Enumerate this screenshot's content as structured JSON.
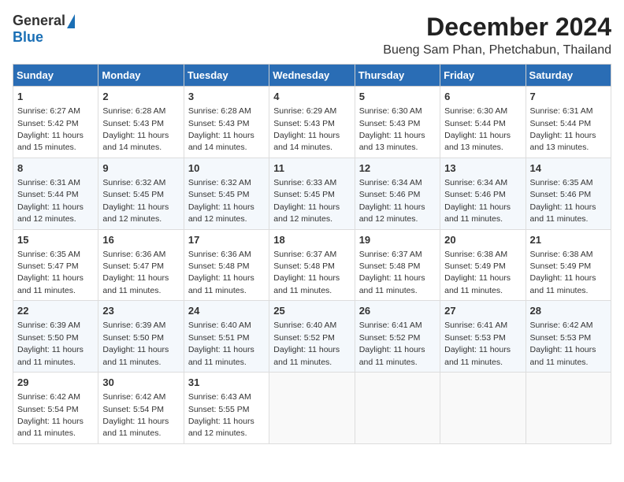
{
  "header": {
    "logo_general": "General",
    "logo_blue": "Blue",
    "month_title": "December 2024",
    "location": "Bueng Sam Phan, Phetchabun, Thailand"
  },
  "days_of_week": [
    "Sunday",
    "Monday",
    "Tuesday",
    "Wednesday",
    "Thursday",
    "Friday",
    "Saturday"
  ],
  "weeks": [
    [
      {
        "day": "1",
        "sunrise": "6:27 AM",
        "sunset": "5:42 PM",
        "daylight": "11 hours and 15 minutes."
      },
      {
        "day": "2",
        "sunrise": "6:28 AM",
        "sunset": "5:43 PM",
        "daylight": "11 hours and 14 minutes."
      },
      {
        "day": "3",
        "sunrise": "6:28 AM",
        "sunset": "5:43 PM",
        "daylight": "11 hours and 14 minutes."
      },
      {
        "day": "4",
        "sunrise": "6:29 AM",
        "sunset": "5:43 PM",
        "daylight": "11 hours and 14 minutes."
      },
      {
        "day": "5",
        "sunrise": "6:30 AM",
        "sunset": "5:43 PM",
        "daylight": "11 hours and 13 minutes."
      },
      {
        "day": "6",
        "sunrise": "6:30 AM",
        "sunset": "5:44 PM",
        "daylight": "11 hours and 13 minutes."
      },
      {
        "day": "7",
        "sunrise": "6:31 AM",
        "sunset": "5:44 PM",
        "daylight": "11 hours and 13 minutes."
      }
    ],
    [
      {
        "day": "8",
        "sunrise": "6:31 AM",
        "sunset": "5:44 PM",
        "daylight": "11 hours and 12 minutes."
      },
      {
        "day": "9",
        "sunrise": "6:32 AM",
        "sunset": "5:45 PM",
        "daylight": "11 hours and 12 minutes."
      },
      {
        "day": "10",
        "sunrise": "6:32 AM",
        "sunset": "5:45 PM",
        "daylight": "11 hours and 12 minutes."
      },
      {
        "day": "11",
        "sunrise": "6:33 AM",
        "sunset": "5:45 PM",
        "daylight": "11 hours and 12 minutes."
      },
      {
        "day": "12",
        "sunrise": "6:34 AM",
        "sunset": "5:46 PM",
        "daylight": "11 hours and 12 minutes."
      },
      {
        "day": "13",
        "sunrise": "6:34 AM",
        "sunset": "5:46 PM",
        "daylight": "11 hours and 11 minutes."
      },
      {
        "day": "14",
        "sunrise": "6:35 AM",
        "sunset": "5:46 PM",
        "daylight": "11 hours and 11 minutes."
      }
    ],
    [
      {
        "day": "15",
        "sunrise": "6:35 AM",
        "sunset": "5:47 PM",
        "daylight": "11 hours and 11 minutes."
      },
      {
        "day": "16",
        "sunrise": "6:36 AM",
        "sunset": "5:47 PM",
        "daylight": "11 hours and 11 minutes."
      },
      {
        "day": "17",
        "sunrise": "6:36 AM",
        "sunset": "5:48 PM",
        "daylight": "11 hours and 11 minutes."
      },
      {
        "day": "18",
        "sunrise": "6:37 AM",
        "sunset": "5:48 PM",
        "daylight": "11 hours and 11 minutes."
      },
      {
        "day": "19",
        "sunrise": "6:37 AM",
        "sunset": "5:48 PM",
        "daylight": "11 hours and 11 minutes."
      },
      {
        "day": "20",
        "sunrise": "6:38 AM",
        "sunset": "5:49 PM",
        "daylight": "11 hours and 11 minutes."
      },
      {
        "day": "21",
        "sunrise": "6:38 AM",
        "sunset": "5:49 PM",
        "daylight": "11 hours and 11 minutes."
      }
    ],
    [
      {
        "day": "22",
        "sunrise": "6:39 AM",
        "sunset": "5:50 PM",
        "daylight": "11 hours and 11 minutes."
      },
      {
        "day": "23",
        "sunrise": "6:39 AM",
        "sunset": "5:50 PM",
        "daylight": "11 hours and 11 minutes."
      },
      {
        "day": "24",
        "sunrise": "6:40 AM",
        "sunset": "5:51 PM",
        "daylight": "11 hours and 11 minutes."
      },
      {
        "day": "25",
        "sunrise": "6:40 AM",
        "sunset": "5:52 PM",
        "daylight": "11 hours and 11 minutes."
      },
      {
        "day": "26",
        "sunrise": "6:41 AM",
        "sunset": "5:52 PM",
        "daylight": "11 hours and 11 minutes."
      },
      {
        "day": "27",
        "sunrise": "6:41 AM",
        "sunset": "5:53 PM",
        "daylight": "11 hours and 11 minutes."
      },
      {
        "day": "28",
        "sunrise": "6:42 AM",
        "sunset": "5:53 PM",
        "daylight": "11 hours and 11 minutes."
      }
    ],
    [
      {
        "day": "29",
        "sunrise": "6:42 AM",
        "sunset": "5:54 PM",
        "daylight": "11 hours and 11 minutes."
      },
      {
        "day": "30",
        "sunrise": "6:42 AM",
        "sunset": "5:54 PM",
        "daylight": "11 hours and 11 minutes."
      },
      {
        "day": "31",
        "sunrise": "6:43 AM",
        "sunset": "5:55 PM",
        "daylight": "11 hours and 12 minutes."
      },
      null,
      null,
      null,
      null
    ]
  ],
  "labels": {
    "sunrise": "Sunrise:",
    "sunset": "Sunset:",
    "daylight": "Daylight:"
  }
}
